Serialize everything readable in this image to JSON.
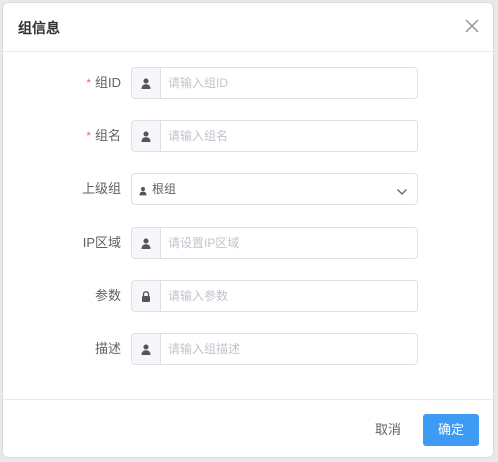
{
  "dialog": {
    "title": "组信息",
    "close_icon": "close-icon"
  },
  "form": {
    "group_id": {
      "required_mark": "*",
      "label": "组ID",
      "placeholder": "请输入组ID",
      "value": "",
      "icon": "user-icon"
    },
    "group_name": {
      "required_mark": "*",
      "label": "组名",
      "placeholder": "请输入组名",
      "value": "",
      "icon": "user-icon"
    },
    "parent_group": {
      "label": "上级组",
      "value": "根组",
      "icon": "user-icon",
      "dropdown_icon": "chevron-down-icon"
    },
    "ip_range": {
      "label": "IP区域",
      "placeholder": "请设置IP区域",
      "value": "",
      "icon": "user-icon"
    },
    "params": {
      "label": "参数",
      "placeholder": "请输入参数",
      "value": "",
      "icon": "lock-icon"
    },
    "description": {
      "label": "描述",
      "placeholder": "请输入组描述",
      "value": "",
      "icon": "user-icon"
    }
  },
  "footer": {
    "cancel_label": "取消",
    "confirm_label": "确定"
  },
  "colors": {
    "primary": "#3d9bf3",
    "required": "#f56c6c"
  }
}
